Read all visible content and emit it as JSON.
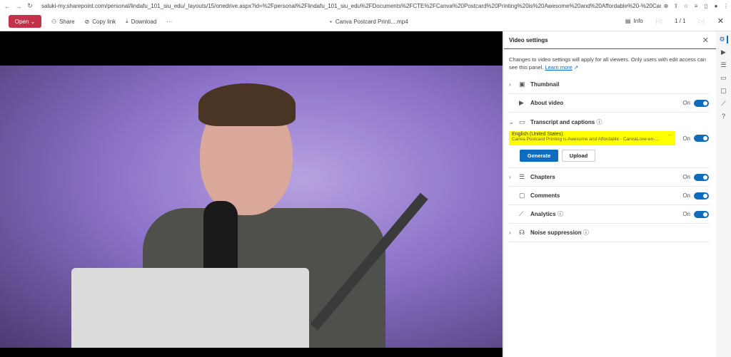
{
  "browser": {
    "url": "saluki-my.sharepoint.com/personal/lindafu_101_siu_edu/_layouts/15/onedrive.aspx?id=%2Fpersonal%2Flindafu_101_siu_edu%2FDocuments%2FCTE%2FCanva%20Postcard%20Printing%20is%20Awesome%20and%20Affordable%20-%20CanvaLove..."
  },
  "toolbar": {
    "open": "Open ⌄",
    "share": "Share",
    "copy_link": "Copy link",
    "download": "Download",
    "more": "···",
    "file_title": "Canva Postcard Printi....mp4",
    "info": "Info",
    "page": "1 / 1"
  },
  "panel": {
    "title": "Video settings",
    "desc": "Changes to video settings will apply for all viewers. Only users with edit access can see this panel.",
    "learn_more": "Learn more",
    "on": "On",
    "thumbnail": "Thumbnail",
    "about": "About video",
    "transcript": "Transcript and captions",
    "caption_lang": "English (United States)",
    "caption_file": "Canva Postcard Printing is Awesome and Affordable - CanvaLove-en-...",
    "generate": "Generate",
    "upload": "Upload",
    "chapters": "Chapters",
    "comments": "Comments",
    "analytics": "Analytics",
    "noise": "Noise suppression"
  },
  "colors": {
    "accent": "#0f6cbd",
    "open_button": "#c4314b",
    "highlight": "#ffff00"
  }
}
